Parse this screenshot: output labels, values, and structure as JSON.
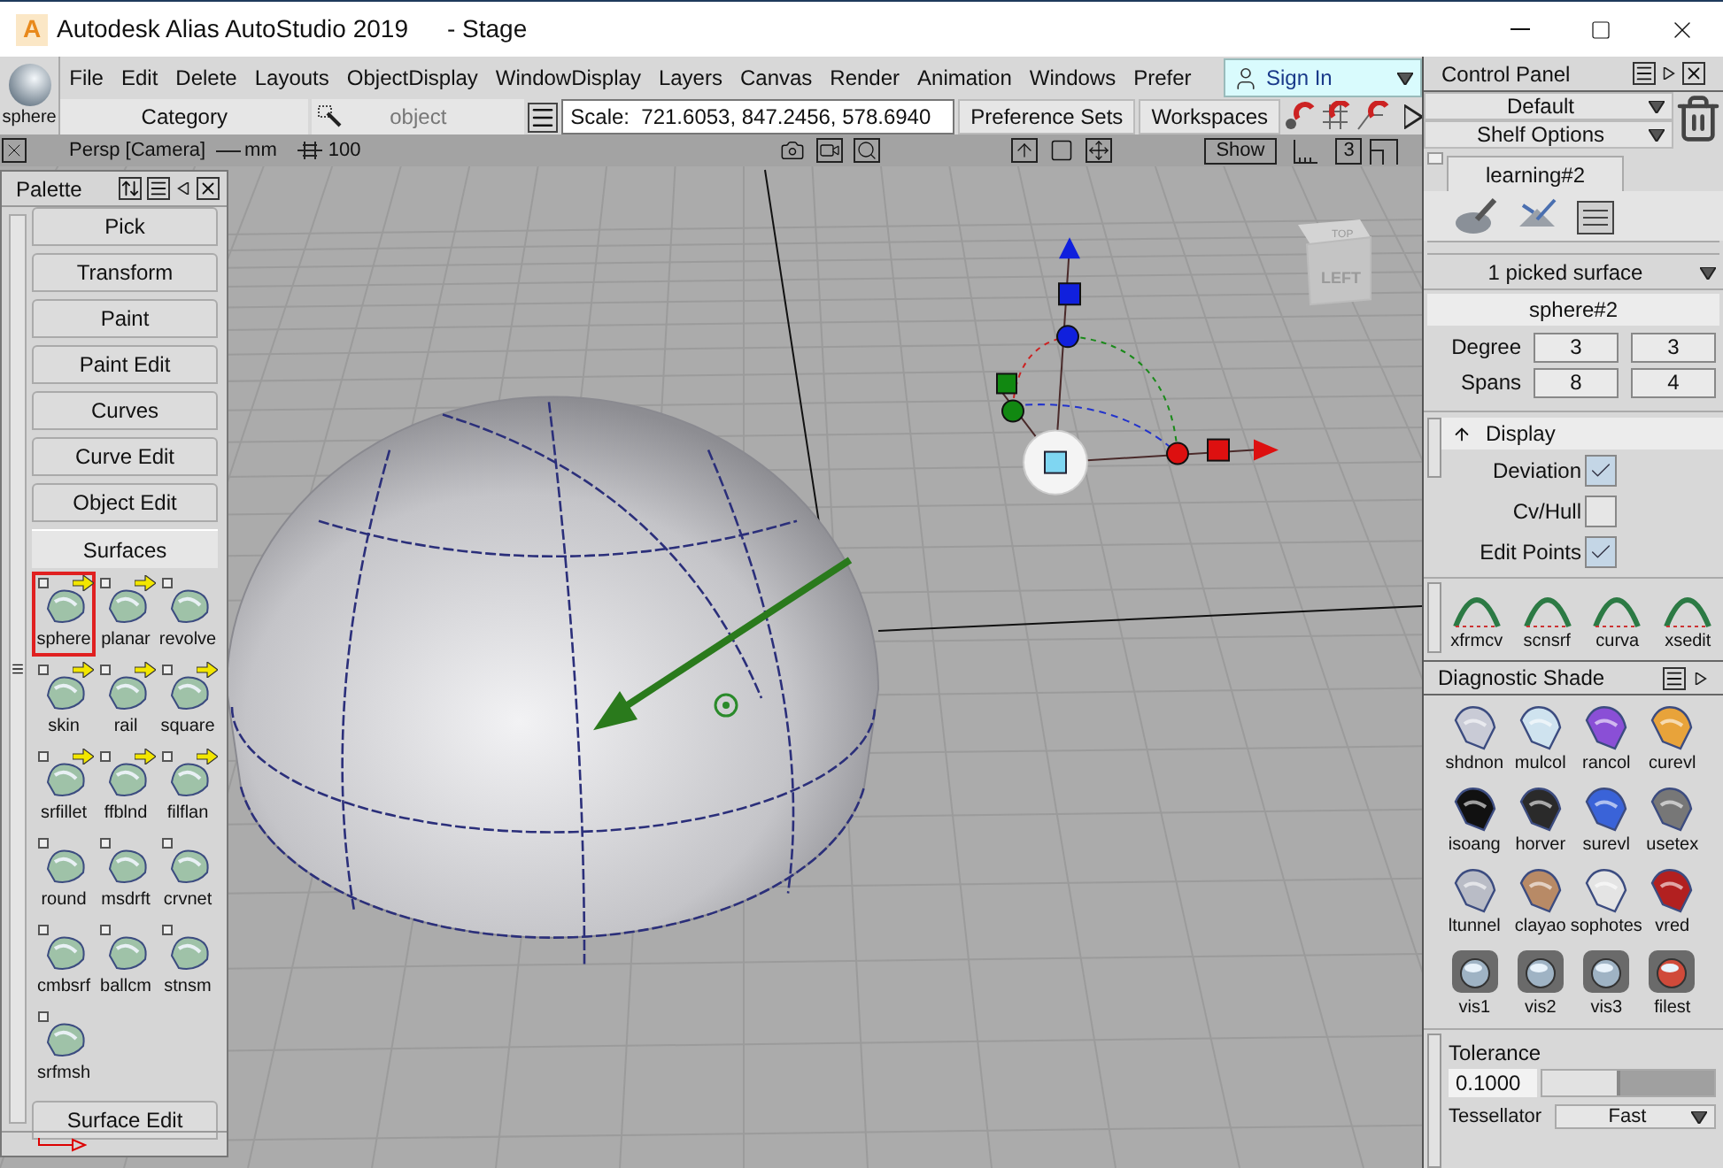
{
  "window": {
    "logo": "A",
    "title": "Autodesk Alias AutoStudio 2019",
    "document": "- Stage"
  },
  "current_tool": {
    "label": "sphere"
  },
  "menu": [
    "File",
    "Edit",
    "Delete",
    "Layouts",
    "ObjectDisplay",
    "WindowDisplay",
    "Layers",
    "Canvas",
    "Render",
    "Animation",
    "Windows",
    "Prefer"
  ],
  "sign_in": {
    "label": "Sign In"
  },
  "toolbar": {
    "category": "Category",
    "object": "object",
    "scale": "Scale:  721.6053, 847.2456, 578.6940",
    "buttons": [
      "Preference Sets",
      "Workspaces"
    ]
  },
  "view_bar": {
    "camera": "Persp [Camera]",
    "units": "mm",
    "grid": "100",
    "show": "Show",
    "count": "3"
  },
  "view_cube": {
    "top": "TOP",
    "side": "LEFT"
  },
  "palette": {
    "title": "Palette",
    "tabs": [
      {
        "label": "Pick",
        "expanded": false
      },
      {
        "label": "Transform",
        "expanded": false
      },
      {
        "label": "Paint",
        "expanded": false
      },
      {
        "label": "Paint Edit",
        "expanded": false
      },
      {
        "label": "Curves",
        "expanded": false
      },
      {
        "label": "Curve Edit",
        "expanded": false
      },
      {
        "label": "Object Edit",
        "expanded": false
      },
      {
        "label": "Surfaces",
        "expanded": true,
        "tools": [
          {
            "label": "sphere",
            "selected": true,
            "options": true
          },
          {
            "label": "planar",
            "selected": false,
            "options": true
          },
          {
            "label": "revolve",
            "selected": false,
            "options": false
          },
          {
            "label": "skin",
            "selected": false,
            "options": true
          },
          {
            "label": "rail",
            "selected": false,
            "options": true
          },
          {
            "label": "square",
            "selected": false,
            "options": true
          },
          {
            "label": "srfillet",
            "selected": false,
            "options": true
          },
          {
            "label": "ffblnd",
            "selected": false,
            "options": true
          },
          {
            "label": "filflan",
            "selected": false,
            "options": true
          },
          {
            "label": "round",
            "selected": false,
            "options": false
          },
          {
            "label": "msdrft",
            "selected": false,
            "options": false
          },
          {
            "label": "crvnet",
            "selected": false,
            "options": false
          },
          {
            "label": "cmbsrf",
            "selected": false,
            "options": false
          },
          {
            "label": "ballcm",
            "selected": false,
            "options": false
          },
          {
            "label": "stnsm",
            "selected": false,
            "options": false
          },
          {
            "label": "srfmsh",
            "selected": false,
            "options": false
          }
        ]
      },
      {
        "label": "Surface Edit",
        "expanded": false
      }
    ]
  },
  "control_panel": {
    "title": "Control Panel",
    "shelf_set": "Default",
    "shelf_options": "Shelf Options",
    "shelf_tab": "learning#2",
    "picked": "1 picked surface",
    "object_name": "sphere#2",
    "degree": {
      "label": "Degree",
      "values": [
        "3",
        "3"
      ]
    },
    "spans": {
      "label": "Spans",
      "values": [
        "8",
        "4"
      ]
    },
    "display": {
      "title": "Display",
      "options": [
        {
          "label": "Deviation",
          "checked": true
        },
        {
          "label": "Cv/Hull",
          "checked": false
        },
        {
          "label": "Edit Points",
          "checked": true
        }
      ]
    },
    "shelf_tools": [
      "xfrmcv",
      "scnsrf",
      "curva",
      "xsedit"
    ]
  },
  "diagnostic_shade": {
    "title": "Diagnostic Shade",
    "modes": [
      {
        "label": "shdnon",
        "kind": "shape",
        "color": "#c9cbd6"
      },
      {
        "label": "mulcol",
        "kind": "shape",
        "color": "#cfe3ef"
      },
      {
        "label": "rancol",
        "kind": "shape",
        "color": "#8a4fd6"
      },
      {
        "label": "curevl",
        "kind": "shape",
        "color": "#e8a33a"
      },
      {
        "label": "isoang",
        "kind": "shape",
        "color": "#111111"
      },
      {
        "label": "horver",
        "kind": "shape",
        "color": "#2a2a2a"
      },
      {
        "label": "surevl",
        "kind": "shape",
        "color": "#3a63d8"
      },
      {
        "label": "usetex",
        "kind": "shape",
        "color": "#777777"
      },
      {
        "label": "ltunnel",
        "kind": "shape",
        "color": "#b9bcc6"
      },
      {
        "label": "clayao",
        "kind": "shape",
        "color": "#b88a66"
      },
      {
        "label": "sophotes",
        "kind": "shape",
        "color": "#e4e4e4"
      },
      {
        "label": "vred",
        "kind": "shape",
        "color": "#b22020"
      },
      {
        "label": "vis1",
        "kind": "ball",
        "color": "#9fb3c4"
      },
      {
        "label": "vis2",
        "kind": "ball",
        "color": "#9fb3c4"
      },
      {
        "label": "vis3",
        "kind": "ball",
        "color": "#9fb3c4"
      },
      {
        "label": "filest",
        "kind": "ball",
        "color": "#d04a3a"
      }
    ]
  },
  "tolerance": {
    "label": "Tolerance",
    "value": "0.1000",
    "level": 0.45
  },
  "tessellator": {
    "label": "Tessellator",
    "value": "Fast"
  }
}
